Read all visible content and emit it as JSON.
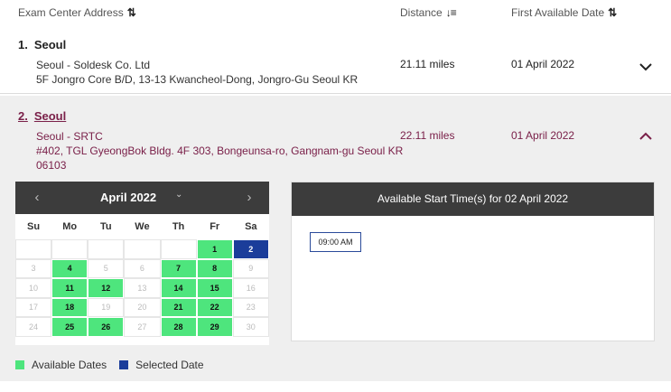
{
  "header": {
    "address_label": "Exam Center Address",
    "distance_label": "Distance",
    "first_date_label": "First Available Date"
  },
  "rows": [
    {
      "number": "1.",
      "city": "Seoul",
      "name": "Seoul - Soldesk Co. Ltd",
      "address1": "5F Jongro Core B/D, 13-13 Kwancheol-Dong, Jongro-Gu Seoul KR",
      "address2": "",
      "distance": "21.11 miles",
      "first_date": "01 April 2022",
      "expanded": false
    },
    {
      "number": "2.",
      "city": "Seoul",
      "name": "Seoul - SRTC",
      "address1": "#402, TGL GyeongBok Bldg. 4F 303, Bongeunsa-ro, Gangnam-gu Seoul KR",
      "address2": "06103",
      "distance": "22.11 miles",
      "first_date": "01 April 2022",
      "expanded": true
    }
  ],
  "calendar": {
    "month_label": "April 2022",
    "prev_icon": "chevron-left-icon",
    "next_icon": "chevron-right-icon",
    "weekdays": [
      "Su",
      "Mo",
      "Tu",
      "We",
      "Th",
      "Fr",
      "Sa"
    ],
    "weeks": [
      [
        {
          "d": "",
          "s": "blank"
        },
        {
          "d": "",
          "s": "blank"
        },
        {
          "d": "",
          "s": "blank"
        },
        {
          "d": "",
          "s": "blank"
        },
        {
          "d": "",
          "s": "blank"
        },
        {
          "d": "1",
          "s": "avail"
        },
        {
          "d": "2",
          "s": "selected"
        }
      ],
      [
        {
          "d": "3",
          "s": "off"
        },
        {
          "d": "4",
          "s": "avail"
        },
        {
          "d": "5",
          "s": "off"
        },
        {
          "d": "6",
          "s": "off"
        },
        {
          "d": "7",
          "s": "avail"
        },
        {
          "d": "8",
          "s": "avail"
        },
        {
          "d": "9",
          "s": "off"
        }
      ],
      [
        {
          "d": "10",
          "s": "off"
        },
        {
          "d": "11",
          "s": "avail"
        },
        {
          "d": "12",
          "s": "avail"
        },
        {
          "d": "13",
          "s": "off"
        },
        {
          "d": "14",
          "s": "avail"
        },
        {
          "d": "15",
          "s": "avail"
        },
        {
          "d": "16",
          "s": "off"
        }
      ],
      [
        {
          "d": "17",
          "s": "off"
        },
        {
          "d": "18",
          "s": "avail"
        },
        {
          "d": "19",
          "s": "off"
        },
        {
          "d": "20",
          "s": "off"
        },
        {
          "d": "21",
          "s": "avail"
        },
        {
          "d": "22",
          "s": "avail"
        },
        {
          "d": "23",
          "s": "off"
        }
      ],
      [
        {
          "d": "24",
          "s": "off"
        },
        {
          "d": "25",
          "s": "avail"
        },
        {
          "d": "26",
          "s": "avail"
        },
        {
          "d": "27",
          "s": "off"
        },
        {
          "d": "28",
          "s": "avail"
        },
        {
          "d": "29",
          "s": "avail"
        },
        {
          "d": "30",
          "s": "off"
        }
      ]
    ]
  },
  "legend": {
    "available_label": "Available Dates",
    "selected_label": "Selected Date",
    "available_color": "#4ee57d",
    "selected_color": "#1b3d9a"
  },
  "times": {
    "title": "Available Start Time(s) for 02 April 2022",
    "slots": [
      "09:00 AM"
    ]
  },
  "colors": {
    "accent": "#7a2049",
    "header_dark": "#3c3c3c"
  }
}
